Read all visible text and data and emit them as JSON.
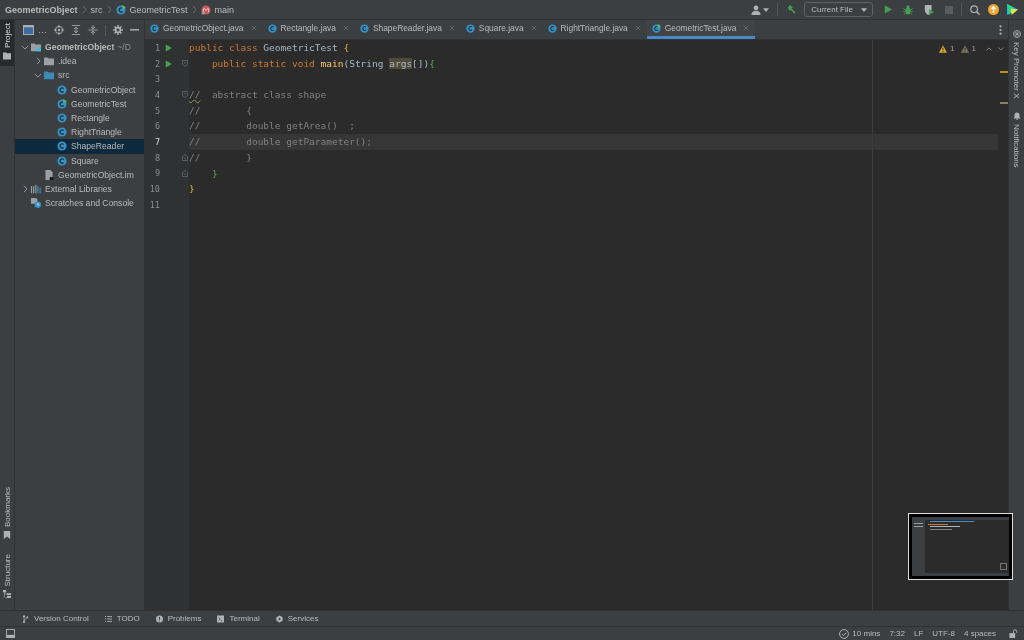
{
  "breadcrumbs": [
    {
      "label": "GeometricObject",
      "kind": "project"
    },
    {
      "label": "src",
      "kind": "folder"
    },
    {
      "label": "GeometricTest",
      "kind": "runnable_class"
    },
    {
      "label": "main",
      "kind": "method"
    }
  ],
  "toolbar": {
    "run_config": "Current File"
  },
  "left_tool_strip": [
    {
      "label": "Project",
      "kind": "folder",
      "selected": true
    },
    {
      "label": "Bookmarks",
      "kind": "bookmark",
      "selected": false
    },
    {
      "label": "Structure",
      "kind": "structure",
      "selected": false
    }
  ],
  "project_panel": {
    "title": "…",
    "tree": [
      {
        "label": "GeometricObject",
        "path": "~/D",
        "kind": "module",
        "expanded": true,
        "selected": false,
        "children": [
          {
            "label": ".idea",
            "kind": "folder",
            "expanded": false,
            "selected": false
          },
          {
            "label": "src",
            "kind": "source_folder",
            "expanded": true,
            "selected": false,
            "children": [
              {
                "label": "GeometricObject",
                "kind": "class",
                "selected": false
              },
              {
                "label": "GeometricTest",
                "kind": "runnable_class",
                "selected": false
              },
              {
                "label": "Rectangle",
                "kind": "class",
                "selected": false
              },
              {
                "label": "RightTriangle",
                "kind": "class",
                "selected": false
              },
              {
                "label": "ShapeReader",
                "kind": "class",
                "selected": true
              },
              {
                "label": "Square",
                "kind": "class",
                "selected": false
              }
            ]
          },
          {
            "label": "GeometricObject.im",
            "kind": "module_file",
            "selected": false
          }
        ]
      },
      {
        "label": "External Libraries",
        "kind": "libraries",
        "expanded": false,
        "selected": false
      },
      {
        "label": "Scratches and Console",
        "kind": "scratches",
        "selected": false
      }
    ]
  },
  "editor": {
    "tabs": [
      {
        "label": "GeometricObject.java",
        "kind": "class",
        "selected": false
      },
      {
        "label": "Rectangle.java",
        "kind": "class",
        "selected": false
      },
      {
        "label": "ShapeReader.java",
        "kind": "class",
        "selected": false
      },
      {
        "label": "Square.java",
        "kind": "class",
        "selected": false
      },
      {
        "label": "RightTriangle.java",
        "kind": "class",
        "selected": false
      },
      {
        "label": "GeometricTest.java",
        "kind": "runnable_class",
        "selected": true
      }
    ],
    "inspections": [
      {
        "kind": "warning",
        "count": "1"
      },
      {
        "kind": "weak_warning",
        "count": "1"
      }
    ],
    "lines": [
      {
        "number": "1",
        "kind": "plain",
        "run": true,
        "current": false,
        "tokens": [
          {
            "text": "public class ",
            "kind": "keyword"
          },
          {
            "text": "GeometricTest ",
            "kind": "plain"
          },
          {
            "text": "{",
            "kind": "brace"
          }
        ]
      },
      {
        "number": "2",
        "kind": "fold_start",
        "run": true,
        "current": false,
        "tokens": [
          {
            "text": "    public static void ",
            "kind": "keyword"
          },
          {
            "text": "main",
            "kind": "method_decl"
          },
          {
            "text": "(String ",
            "kind": "plain"
          },
          {
            "text": "args",
            "kind": "usage"
          },
          {
            "text": "[])",
            "kind": "plain"
          },
          {
            "text": "{",
            "kind": "matched_brace"
          }
        ]
      },
      {
        "number": "3",
        "kind": "plain",
        "run": false,
        "current": false
      },
      {
        "number": "4",
        "kind": "fold_start",
        "run": false,
        "current": false,
        "tokens": [
          {
            "text": "//",
            "kind": "typo"
          },
          {
            "text": "  abstract class shape",
            "kind": "comment"
          }
        ]
      },
      {
        "number": "5",
        "kind": "plain",
        "run": false,
        "current": false,
        "tokens": [
          {
            "text": "//        {",
            "kind": "comment"
          }
        ]
      },
      {
        "number": "6",
        "kind": "plain",
        "run": false,
        "current": false,
        "tokens": [
          {
            "text": "//        double getArea()  ;",
            "kind": "comment"
          }
        ]
      },
      {
        "number": "7",
        "kind": "plain",
        "run": false,
        "current": true,
        "tokens": [
          {
            "text": "//        double getParameter();",
            "kind": "comment"
          }
        ]
      },
      {
        "number": "8",
        "kind": "fold_end",
        "run": false,
        "current": false,
        "tokens": [
          {
            "text": "//        }",
            "kind": "comment"
          }
        ]
      },
      {
        "number": "9",
        "kind": "fold_end",
        "run": false,
        "current": false,
        "tokens": [
          {
            "text": "    }",
            "kind": "matched_brace"
          }
        ]
      },
      {
        "number": "10",
        "kind": "plain",
        "run": false,
        "current": false,
        "tokens": [
          {
            "text": "}",
            "kind": "brace"
          }
        ]
      },
      {
        "number": "11",
        "kind": "plain",
        "run": false,
        "current": false
      }
    ]
  },
  "right_tool_strip": [
    {
      "label": "Key Promoter X",
      "kind": "key_promoter"
    },
    {
      "label": "Notifications",
      "kind": "notifications"
    }
  ],
  "tool_window_bar": [
    {
      "label": "Version Control",
      "kind": "vcs"
    },
    {
      "label": "TODO",
      "kind": "todo"
    },
    {
      "label": "Problems",
      "kind": "problems"
    },
    {
      "label": "Terminal",
      "kind": "terminal"
    },
    {
      "label": "Services",
      "kind": "services"
    }
  ],
  "status_bar": {
    "items": [
      {
        "text": "10 mins",
        "kind": "timer"
      },
      {
        "text": "7:32",
        "kind": "text"
      },
      {
        "text": "LF",
        "kind": "text"
      },
      {
        "text": "UTF-8",
        "kind": "text"
      },
      {
        "text": "4 spaces",
        "kind": "text"
      }
    ]
  }
}
